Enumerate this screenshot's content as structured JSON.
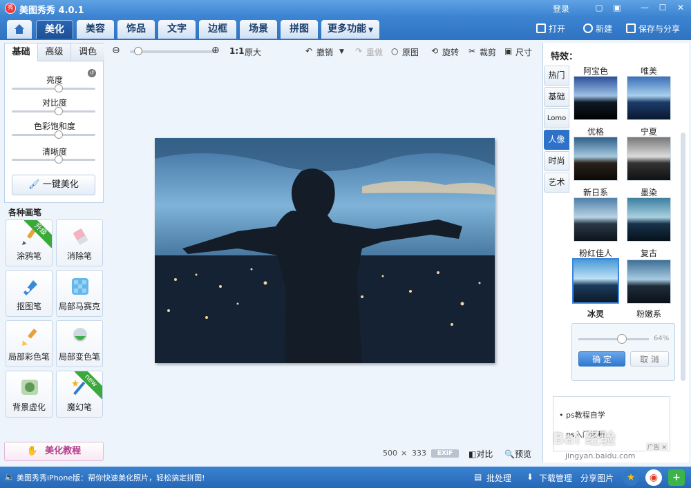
{
  "titlebar": {
    "app_title": "美图秀秀 4.0.1",
    "logo_text": "秀",
    "login": "登录"
  },
  "tabs": [
    "美化",
    "美容",
    "饰品",
    "文字",
    "边框",
    "场景",
    "拼图",
    "更多功能"
  ],
  "tab_actions": {
    "open": "打开",
    "new": "新建",
    "save": "保存与分享"
  },
  "toolbar": {
    "ratio": "1:1",
    "original_size": "原大",
    "undo": "撤销",
    "redo": "重做",
    "reset": "原图",
    "rotate": "旋转",
    "crop": "裁剪",
    "resize": "尺寸",
    "zoom_level": 0.1
  },
  "left_panel": {
    "tabs": [
      "基础",
      "高级",
      "调色"
    ],
    "sliders": [
      {
        "label": "亮度",
        "value": 0.5
      },
      {
        "label": "对比度",
        "value": 0.5
      },
      {
        "label": "色彩饱和度",
        "value": 0.5
      },
      {
        "label": "清晰度",
        "value": 0.5
      }
    ],
    "one_click": "一键美化"
  },
  "brushes": {
    "title": "各种画笔",
    "items": [
      "涂鸦笔",
      "消除笔",
      "抠图笔",
      "局部马赛克",
      "局部彩色笔",
      "局部变色笔",
      "背景虚化",
      "魔幻笔"
    ],
    "badge_upgrade": "升级",
    "badge_new": "new"
  },
  "tutorial_button": "美化教程",
  "canvas": {
    "width_px": "500",
    "times": "×",
    "height_px": "333",
    "exif": "EXIF",
    "compare": "对比",
    "preview": "预览"
  },
  "effects": {
    "title": "特效：",
    "categories": [
      "热门",
      "基础",
      "Lomo",
      "人像",
      "时尚",
      "艺术"
    ],
    "items": [
      "阿宝色",
      "唯美",
      "优格",
      "宁夏",
      "新日系",
      "墨染",
      "粉红佳人",
      "复古",
      "冰灵",
      "粉嫩系"
    ],
    "strength_pct": "64%",
    "ok": "确 定",
    "cancel": "取 消"
  },
  "ad": {
    "items": [
      "ps教程自学",
      "ps入门课程"
    ],
    "tag": "广告"
  },
  "statusbar": {
    "promo": "美图秀秀iPhone版：帮你快速美化照片，轻松搞定拼图!",
    "batch": "批处理",
    "download": "下载管理",
    "share": "分享图片"
  },
  "watermark": {
    "site": "Bai 经验",
    "url": "jingyan.baidu.com"
  }
}
